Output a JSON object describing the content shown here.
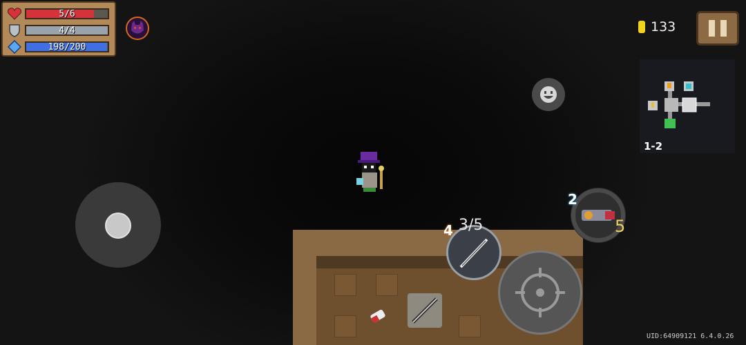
{
  "hud": {
    "hp": {
      "text": "5/6",
      "value": 5,
      "max": 6,
      "icon": "heart-icon",
      "color": "#d4333b"
    },
    "armor": {
      "text": "4/4",
      "value": 4,
      "max": 4,
      "icon": "shield-icon",
      "color": "#9aa3ab"
    },
    "energy": {
      "text": "198/200",
      "value": 198,
      "max": 200,
      "icon": "energy-gem-icon",
      "color": "#3f6fe0"
    },
    "buff_icon": "demon-helmet-buff-icon"
  },
  "coins": {
    "count": "133",
    "icon": "gold-coin-icon"
  },
  "pause_icon": "pause-icon",
  "minimap": {
    "floor_label": "1-2"
  },
  "emote_icon": "smiley-emote-icon",
  "weapon": {
    "energy_cost": "4",
    "ammo": "3/5"
  },
  "secondary_weapon": {
    "energy_cost": "2",
    "ammo": "5"
  },
  "attack_icon": "crosshair-icon",
  "footer": {
    "uid": "UID:64909121 6.4.0.26"
  }
}
